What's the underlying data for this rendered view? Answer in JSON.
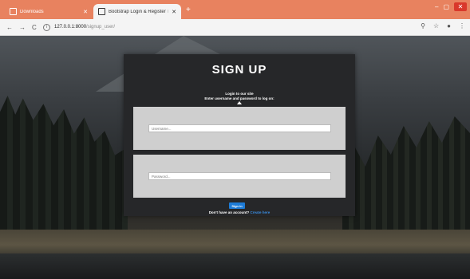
{
  "browser": {
    "tabs": [
      {
        "label": "Downloads",
        "active": false
      },
      {
        "label": "Bootstrap Login & Register Tem...",
        "active": true
      }
    ],
    "new_tab_icon": "plus-icon",
    "address": {
      "host": "127.0.0.1:8000",
      "path": "/signup_user/"
    },
    "accent_color": "#e8825f"
  },
  "signup": {
    "title": "SIGN UP",
    "subtitle": "Login to our site",
    "instructions": "Enter username and password to log on:",
    "username_placeholder": "Username...",
    "password_placeholder": "Password...",
    "submit_label": "Sign in",
    "account_prompt": "Don't have an account?",
    "account_link": "Create here",
    "button_color": "#1d7bd6"
  }
}
